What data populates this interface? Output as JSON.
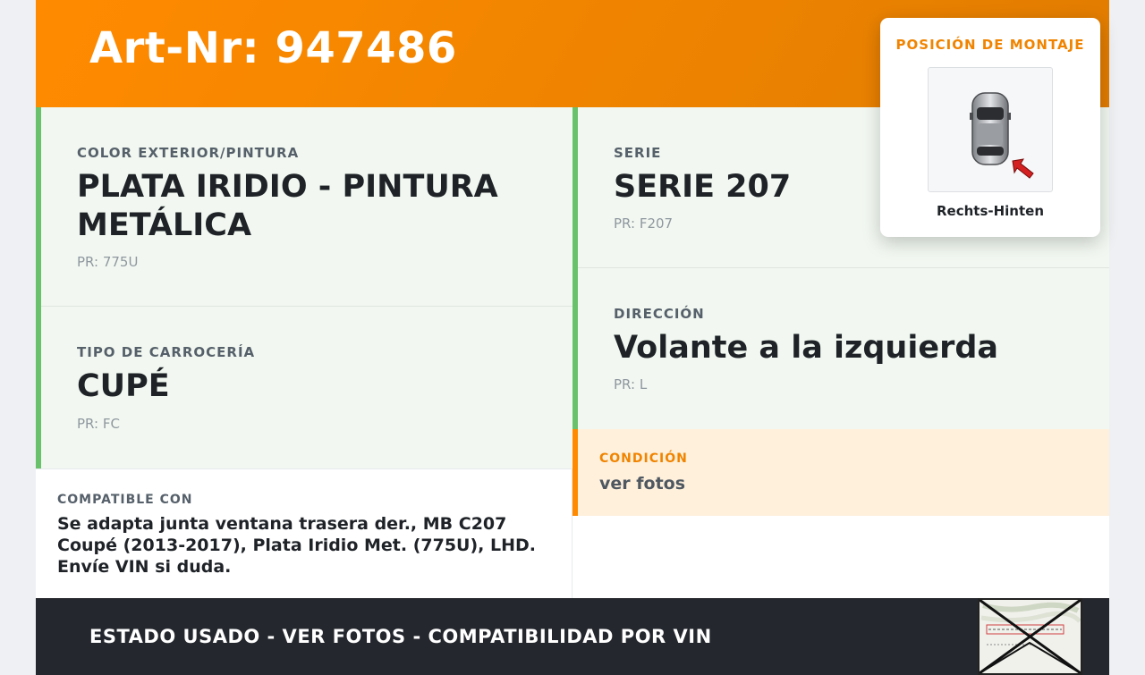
{
  "header": {
    "title": "Art-Nr: 947486"
  },
  "cells": {
    "color": {
      "label": "COLOR EXTERIOR/PINTURA",
      "value": "PLATA IRIDIO - PINTURA METÁLICA",
      "pr": "PR: 775U"
    },
    "body_type": {
      "label": "TIPO DE CARROCERÍA",
      "value": "CUPÉ",
      "pr": "PR: FC"
    },
    "series": {
      "label": "SERIE",
      "value": "SERIE 207",
      "pr": "PR: F207"
    },
    "steering": {
      "label": "DIRECCIÓN",
      "value": "Volante a la izquierda",
      "pr": "PR: L"
    }
  },
  "condition": {
    "label": "CONDICIÓN",
    "value": "ver fotos"
  },
  "compatible": {
    "label": "COMPATIBLE CON",
    "value": "Se adapta junta ventana trasera der., MB C207 Coupé (2013-2017), Plata Iridio Met. (775U), LHD. Envíe VIN si duda."
  },
  "footer": {
    "text": "ESTADO USADO - VER FOTOS - COMPATIBILIDAD POR VIN"
  },
  "mount": {
    "title": "POSICIÓN DE MONTAJE",
    "caption": "Rechts-Hinten",
    "image_icon": "car-top-view-icon",
    "arrow_icon": "red-arrow-icon"
  },
  "colors": {
    "accent": "#ff8a00",
    "green": "#6ac16c",
    "cell_bg": "#f2f8f1",
    "footer_bg": "#24272d"
  }
}
